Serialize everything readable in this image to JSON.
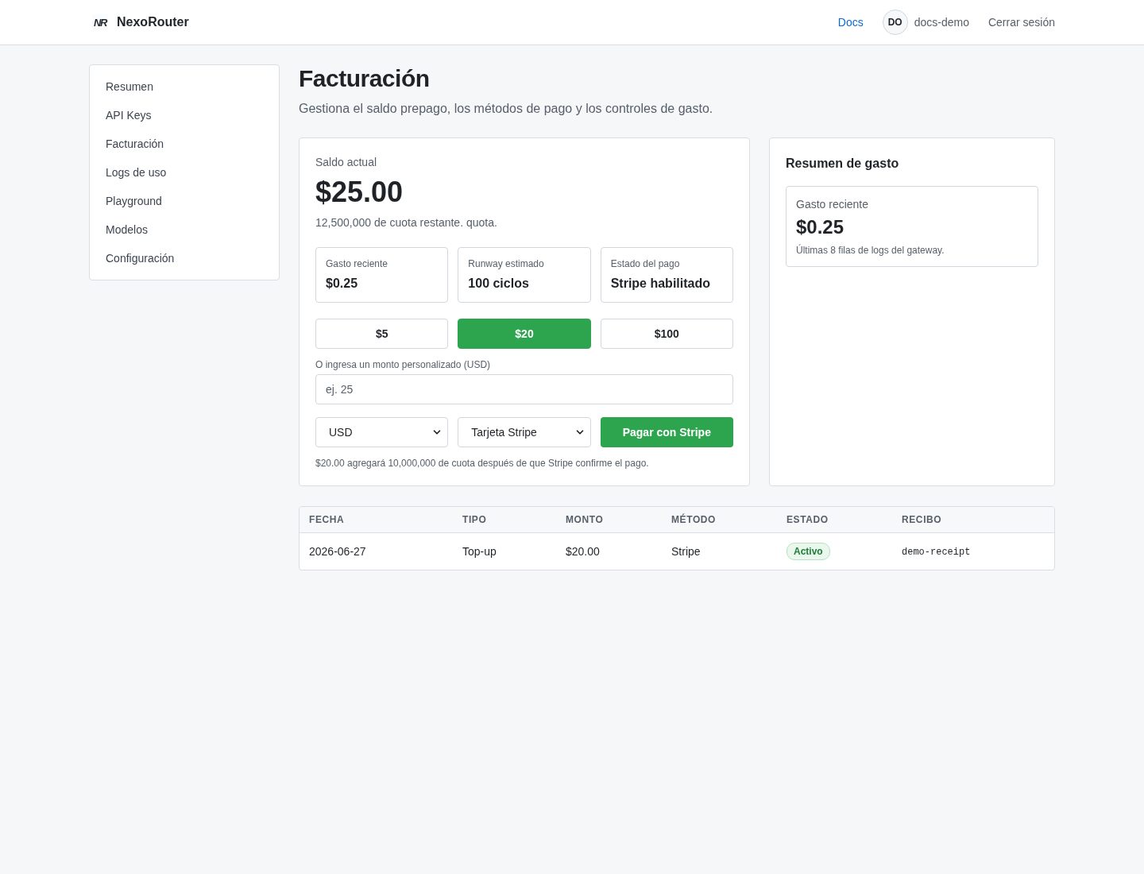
{
  "header": {
    "brand": {
      "mark": "NR",
      "name": "NexoRouter"
    },
    "docs_link": "Docs",
    "user": {
      "initials": "DO",
      "name": "docs-demo"
    },
    "logout": "Cerrar sesión"
  },
  "sidebar": {
    "items": [
      {
        "label": "Resumen"
      },
      {
        "label": "API Keys"
      },
      {
        "label": "Facturación"
      },
      {
        "label": "Logs de uso"
      },
      {
        "label": "Playground"
      },
      {
        "label": "Modelos"
      },
      {
        "label": "Configuración"
      }
    ]
  },
  "page": {
    "title": "Facturación",
    "subtitle": "Gestiona el saldo prepago, los métodos de pago y los controles de gasto."
  },
  "balance_card": {
    "label": "Saldo actual",
    "amount": "$25.00",
    "quota_note": "12,500,000 de cuota restante. quota.",
    "stats": [
      {
        "label": "Gasto reciente",
        "value": "$0.25"
      },
      {
        "label": "Runway estimado",
        "value": "100 ciclos"
      },
      {
        "label": "Estado del pago",
        "value": "Stripe habilitado"
      }
    ],
    "amount_options": [
      {
        "label": "$5",
        "selected": false
      },
      {
        "label": "$20",
        "selected": true
      },
      {
        "label": "$100",
        "selected": false
      }
    ],
    "custom_amount": {
      "label": "O ingresa un monto personalizado (USD)",
      "placeholder": "ej. 25"
    },
    "currency_select": {
      "value": "USD"
    },
    "method_select": {
      "value": "Tarjeta Stripe"
    },
    "pay_button": "Pagar con Stripe",
    "confirmation_note": "$20.00 agregará 10,000,000 de cuota después de que Stripe confirme el pago."
  },
  "spend_summary": {
    "title": "Resumen de gasto",
    "stat": {
      "label": "Gasto reciente",
      "value": "$0.25",
      "note": "Últimas 8 filas de logs del gateway."
    }
  },
  "transactions": {
    "columns": [
      "FECHA",
      "TIPO",
      "MONTO",
      "MÉTODO",
      "ESTADO",
      "RECIBO"
    ],
    "rows": [
      {
        "cells": [
          {
            "kind": "text",
            "text": "2026-06-27"
          },
          {
            "kind": "text",
            "text": "Top-up"
          },
          {
            "kind": "text",
            "text": "$20.00"
          },
          {
            "kind": "text",
            "text": "Stripe"
          },
          {
            "kind": "badge",
            "text": "Activo"
          },
          {
            "kind": "code",
            "text": "demo-receipt"
          }
        ]
      }
    ]
  }
}
